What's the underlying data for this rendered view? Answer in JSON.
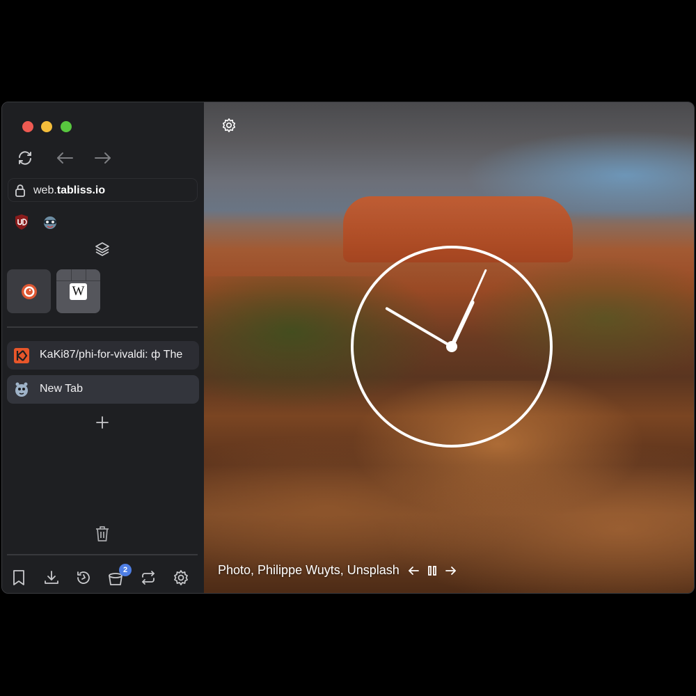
{
  "address_bar": {
    "host_prefix": "web.",
    "host_domain": "tabliss.io"
  },
  "tabs": [
    {
      "label": "KaKi87/phi-for-vivaldi: ф The"
    },
    {
      "label": "New Tab"
    }
  ],
  "panel": {
    "badge_count": "2"
  },
  "photo_credit": {
    "text": "Photo, Philippe Wuyts, Unsplash"
  },
  "clock": {
    "hours": 12,
    "minutes": 50,
    "seconds": 4
  },
  "colors": {
    "sidebar_bg": "#1e1f22",
    "tab_bg": "#2c2d33",
    "badge": "#4e7ee4",
    "accent_tile": "#3b3c41"
  },
  "icons": {
    "reload": "reload-icon",
    "back": "arrow-left-icon",
    "forward": "arrow-right-icon",
    "lock": "lock-icon",
    "workspaces": "stack-icon",
    "add_tab": "plus-icon",
    "trash": "trash-icon",
    "bookmarks": "bookmark-icon",
    "downloads": "download-icon",
    "history": "history-icon",
    "window_panel": "bucket-icon",
    "sync": "sync-icon",
    "settings": "gear-icon"
  }
}
